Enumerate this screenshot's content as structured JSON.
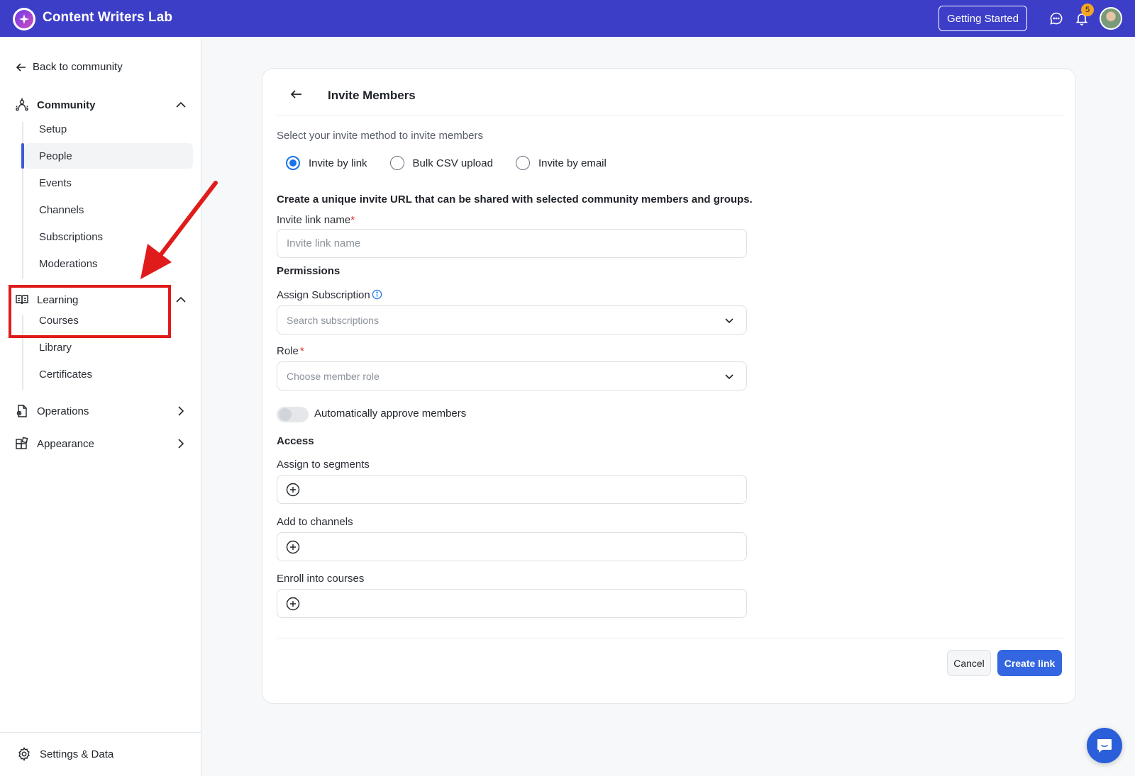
{
  "header": {
    "brand": "Content Writers Lab",
    "getting_started": "Getting Started",
    "notification_count": "5"
  },
  "sidebar": {
    "back_link": "Back to community",
    "community": {
      "label": "Community",
      "items": [
        "Setup",
        "People",
        "Events",
        "Channels",
        "Subscriptions",
        "Moderations"
      ],
      "active": "People"
    },
    "learning": {
      "label": "Learning",
      "items": [
        "Courses",
        "Library",
        "Certificates"
      ]
    },
    "operations": "Operations",
    "appearance": "Appearance",
    "settings": "Settings & Data"
  },
  "card": {
    "title": "Invite Members",
    "method_prompt": "Select your invite method to invite members",
    "methods": [
      "Invite by link",
      "Bulk CSV upload",
      "Invite by email"
    ],
    "selected_method": "Invite by link",
    "description": "Create a unique invite URL that can be shared with selected community members and groups.",
    "link_name_label": "Invite link name",
    "required_mark": "*",
    "link_name_placeholder": "Invite link name",
    "permissions_title": "Permissions",
    "assign_subscription_label": "Assign Subscription",
    "subscription_placeholder": "Search subscriptions",
    "role_label": "Role",
    "role_placeholder": "Choose member role",
    "auto_approve_label": "Automatically approve members",
    "auto_approve_on": false,
    "access_title": "Access",
    "segments_label": "Assign to segments",
    "channels_label": "Add to channels",
    "courses_label": "Enroll into courses",
    "cancel": "Cancel",
    "create": "Create link"
  },
  "colors": {
    "topbar": "#3d3ec8",
    "primary_button": "#3366e0",
    "annotation": "#e01b1b",
    "radio_selected": "#1a73e8"
  }
}
